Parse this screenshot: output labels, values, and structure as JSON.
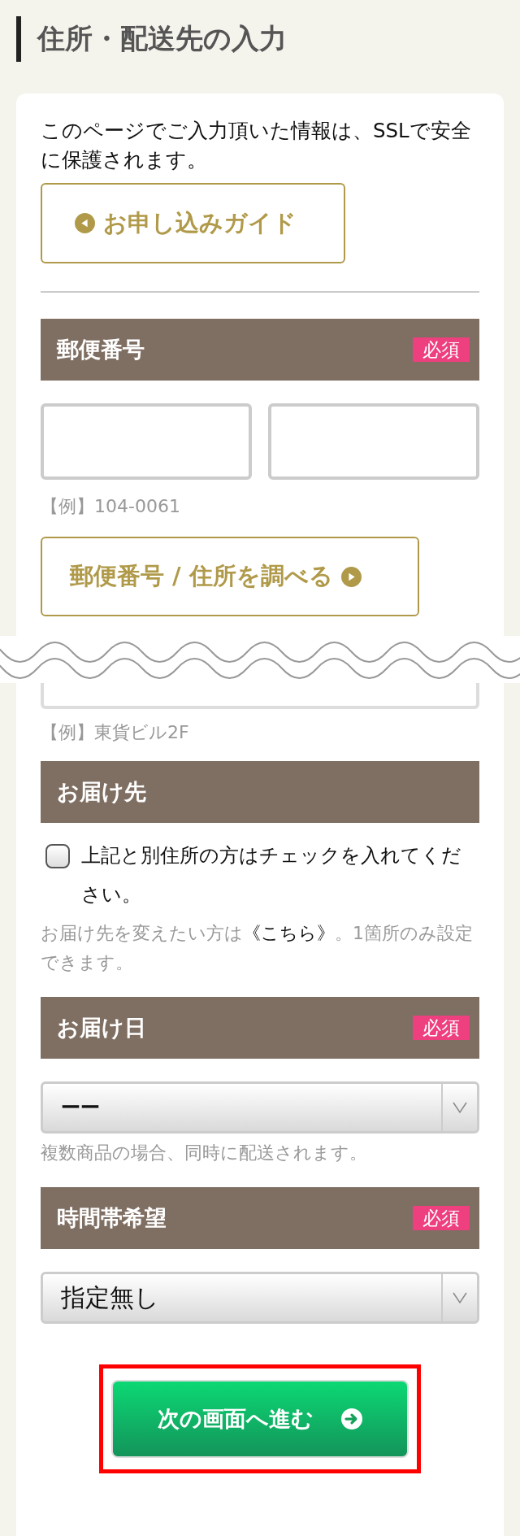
{
  "page_title": "住所・配送先の入力",
  "notice": "このページでご入力頂いた情報は、SSLで安全に保護されます。",
  "guide_button": {
    "label": "お申し込みガイド"
  },
  "postal": {
    "header": {
      "title": "郵便番号",
      "badge": "必須"
    },
    "example": "【例】104-0061",
    "lookup_button": {
      "label": "郵便番号 / 住所を調べる"
    }
  },
  "address_continued": {
    "example": "【例】東貨ビル2F"
  },
  "delivery_address": {
    "header": {
      "title": "お届け先"
    },
    "checkbox": {
      "label": "上記と別住所の方はチェックを入れてください。",
      "checked": false
    },
    "note": {
      "before": "お届け先を変えたい方は",
      "link": "《こちら》",
      "after": "。1箇所のみ設定できます。"
    }
  },
  "delivery_date": {
    "header": {
      "title": "お届け日",
      "badge": "必須"
    },
    "select": {
      "value": "ーー"
    },
    "note": "複数商品の場合、同時に配送されます。"
  },
  "time_slot": {
    "header": {
      "title": "時間帯希望",
      "badge": "必須"
    },
    "select": {
      "value": "指定無し"
    }
  },
  "next_button": {
    "label": "次の画面へ進む",
    "highlighted": true
  }
}
